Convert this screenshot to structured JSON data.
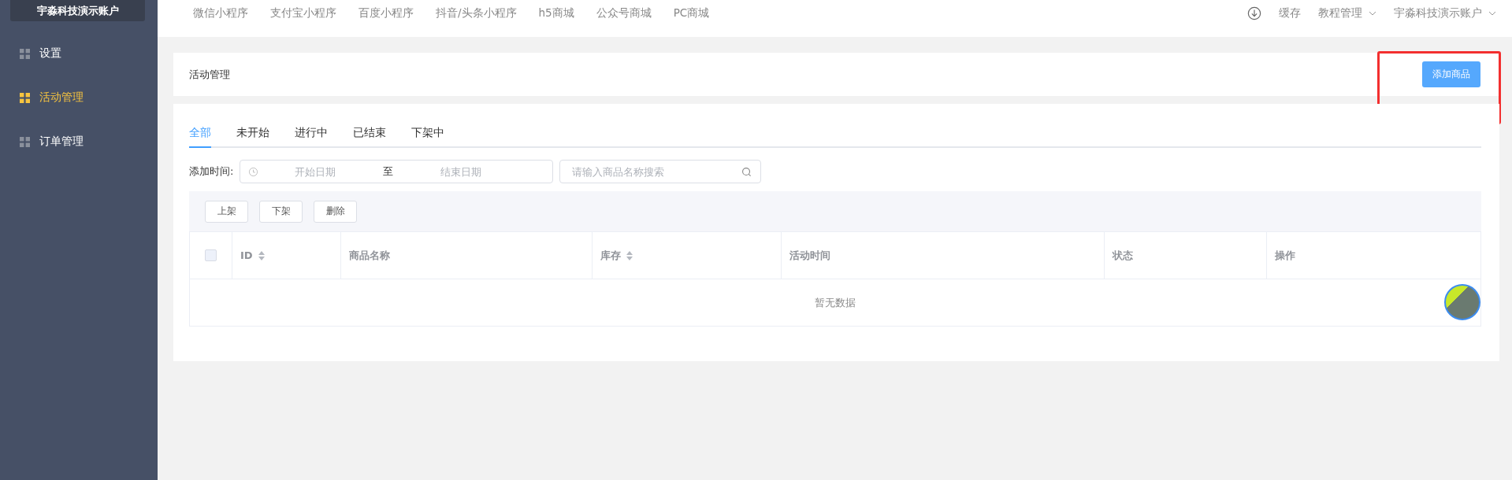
{
  "sidebar": {
    "account": "宇淼科技演示账户",
    "items": [
      {
        "label": "设置",
        "selected": false
      },
      {
        "label": "活动管理",
        "selected": true
      },
      {
        "label": "订单管理",
        "selected": false
      }
    ]
  },
  "top_nav": {
    "links": [
      "微信小程序",
      "支付宝小程序",
      "百度小程序",
      "抖音/头条小程序",
      "h5商城",
      "公众号商城",
      "PC商城"
    ],
    "cache": "缓存",
    "menus": [
      "教程管理",
      "宇淼科技演示账户"
    ]
  },
  "header": {
    "title": "活动管理",
    "add_button": "添加商品",
    "highlighted": true
  },
  "tabs": [
    {
      "label": "全部",
      "selected": true
    },
    {
      "label": "未开始",
      "selected": false
    },
    {
      "label": "进行中",
      "selected": false
    },
    {
      "label": "已结束",
      "selected": false
    },
    {
      "label": "下架中",
      "selected": false
    }
  ],
  "filter": {
    "label": "添加时间:",
    "start_placeholder": "开始日期",
    "separator": "至",
    "end_placeholder": "结束日期",
    "search_placeholder": "请输入商品名称搜索"
  },
  "actions": [
    "上架",
    "下架",
    "删除"
  ],
  "table": {
    "select_all_checked": false,
    "columns": [
      {
        "label": "ID",
        "sortable": true
      },
      {
        "label": "商品名称",
        "sortable": false
      },
      {
        "label": "库存",
        "sortable": true
      },
      {
        "label": "活动时间",
        "sortable": false
      },
      {
        "label": "状态",
        "sortable": false
      },
      {
        "label": "操作",
        "sortable": false
      }
    ],
    "empty_text": "暂无数据"
  }
}
